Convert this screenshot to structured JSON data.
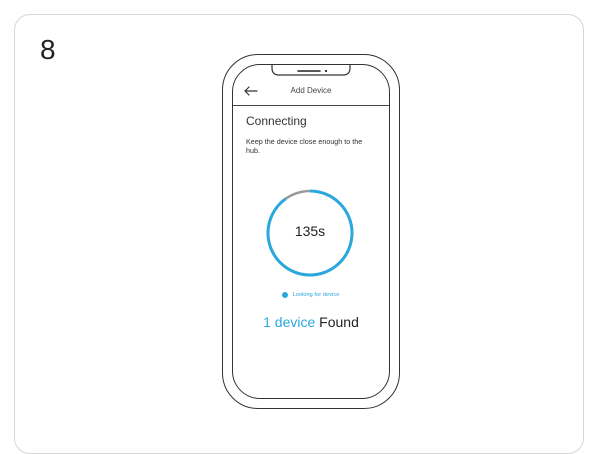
{
  "step": {
    "number": "8"
  },
  "screen": {
    "nav_title": "Add Device",
    "heading": "Connecting",
    "instruction": "Keep the device close enough to the hub.",
    "timer": "135s",
    "progress_fraction": 0.9,
    "status_text": "Looking for device",
    "found_count": "1 device",
    "found_label": "Found"
  },
  "colors": {
    "accent": "#2aa8de",
    "ring_track": "#9a9a9a",
    "outline": "#333333"
  },
  "icons": {
    "back": "back-arrow-icon",
    "status": "status-dot-icon"
  }
}
